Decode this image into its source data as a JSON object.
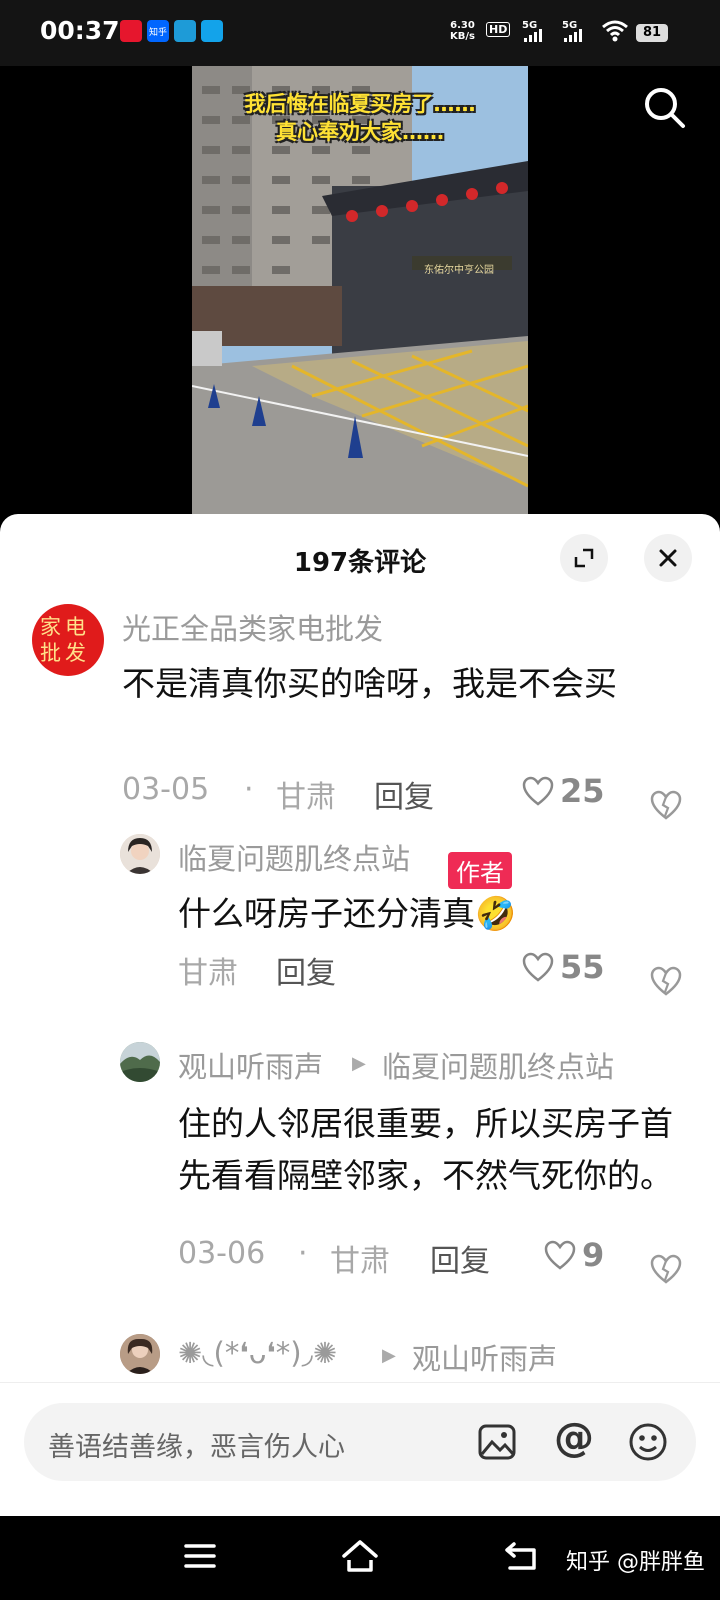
{
  "status": {
    "time": "00:37",
    "app_icons": [
      {
        "icon": "weibo-icon",
        "color": "#e6162d",
        "label": ""
      },
      {
        "icon": "zhihu-icon",
        "color": "#0066ff",
        "label": "知乎"
      },
      {
        "icon": "app-icon",
        "color": "#1e9bd7",
        "label": ""
      },
      {
        "icon": "app-icon",
        "color": "#13a3ea",
        "label": ""
      }
    ],
    "net_speed_value": "6.30",
    "net_speed_unit": "KB/s",
    "hd_label": "HD",
    "signal_1_label": "5G",
    "signal_2_label": "5G",
    "battery": "81"
  },
  "video": {
    "overlay_line1": "我后悔在临夏买房了……",
    "overlay_line2": "真心奉劝大家……",
    "sign_text": "东佑尔中亨公园",
    "search_icon": "search-icon"
  },
  "comments_panel": {
    "title": "197条评论",
    "expand_icon": "expand-icon",
    "close_icon": "close-icon",
    "comments": [
      {
        "user": "光正全品类家电批发",
        "avatar_text": "家电批发",
        "text": "不是清真你买的啥呀，我是不会买",
        "date": "03-05",
        "sep": "·",
        "location": "甘肃",
        "reply": "回复",
        "likes": "25"
      },
      {
        "user": "临夏问题肌终点站",
        "badge": "作者",
        "text": "什么呀房子还分清真🤣",
        "location": "甘肃",
        "reply": "回复",
        "likes": "55"
      },
      {
        "user": "观山听雨声",
        "reply_to": "临夏问题肌终点站",
        "text": "住的人邻居很重要，所以买房子首先看看隔壁邻家，不然气死你的。",
        "date": "03-06",
        "sep": "·",
        "location": "甘肃",
        "reply": "回复",
        "likes": "9"
      },
      {
        "user": "✺◟(*❛ᴗ❛*)◞✺",
        "reply_to": "观山听雨声"
      }
    ]
  },
  "input": {
    "placeholder": "善语结善缘，恶言伤人心",
    "image_icon": "image-icon",
    "at_label": "@",
    "emoji_icon": "emoji-icon"
  },
  "navbar": {
    "menu_icon": "menu-icon",
    "home_icon": "home-icon",
    "back_icon": "back-icon",
    "watermark": "知乎 @胖胖鱼"
  }
}
